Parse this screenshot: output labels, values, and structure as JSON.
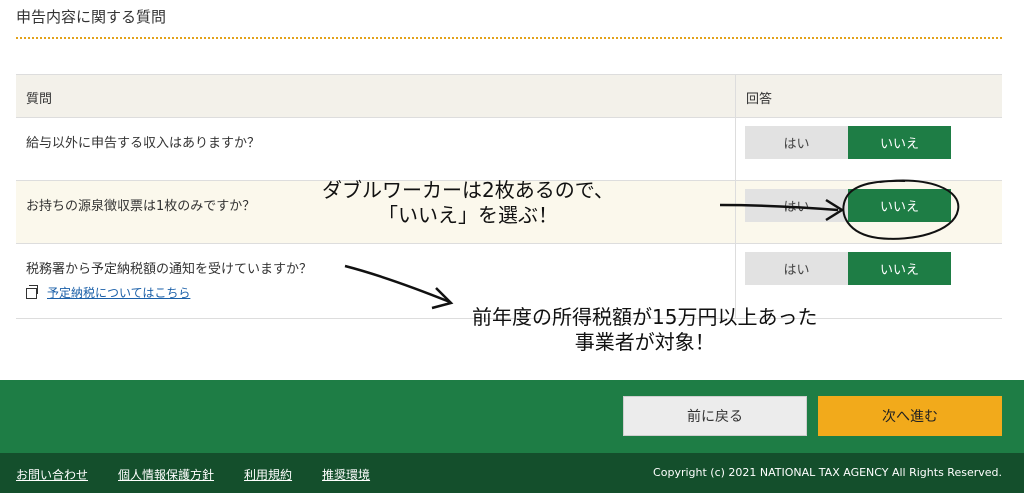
{
  "section_title": "申告内容に関する質問",
  "table": {
    "header_question": "質問",
    "header_answer": "回答",
    "rows": [
      {
        "question": "給与以外に申告する収入はありますか？",
        "yes": "はい",
        "no": "いいえ",
        "selected": "no"
      },
      {
        "question": "お持ちの源泉徴収票は1枚のみですか？",
        "yes": "はい",
        "no": "いいえ",
        "selected": "no"
      },
      {
        "question": "税務署から予定納税額の通知を受けていますか？",
        "link": "予定納税についてはこちら",
        "yes": "はい",
        "no": "いいえ",
        "selected": "no"
      }
    ]
  },
  "annotations": {
    "note1_line1": "ダブルワーカーは2枚あるので、",
    "note1_line2": "「いいえ」を選ぶ！",
    "note2_line1": "前年度の所得税額が15万円以上あった",
    "note2_line2": "事業者が対象！"
  },
  "actions": {
    "back": "前に戻る",
    "next": "次へ進む"
  },
  "footer": {
    "links": [
      "お問い合わせ",
      "個人情報保護方針",
      "利用規約",
      "推奨環境"
    ],
    "copyright": "Copyright (c) 2021 NATIONAL TAX AGENCY All Rights Reserved."
  },
  "colors": {
    "green": "#1e7d45",
    "dark_green": "#144f2c",
    "accent_orange": "#f2aa1b"
  },
  "icons": [
    "external-window-icon",
    "arrow-annotation",
    "circle-annotation"
  ]
}
